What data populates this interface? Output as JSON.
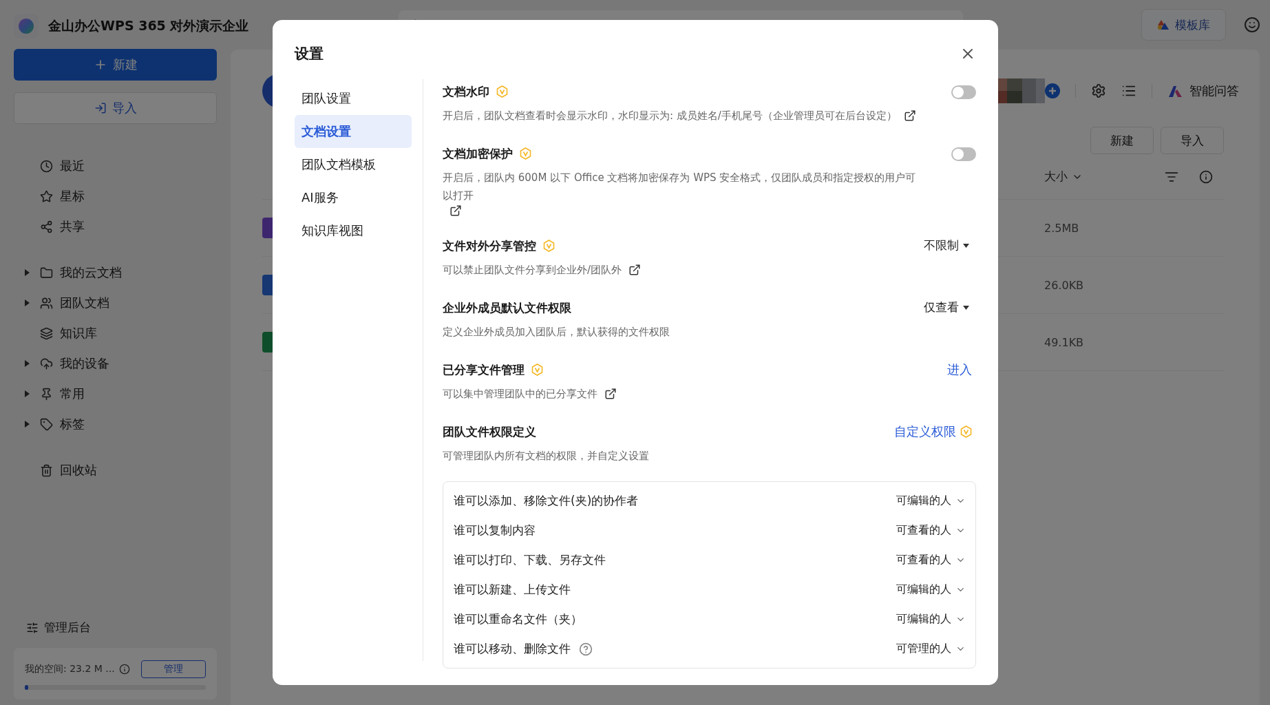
{
  "app": {
    "title": "金山办公WPS 365 对外演示企业",
    "template_button": "模板库"
  },
  "sidebar": {
    "new_button": "新建",
    "import_button": "导入",
    "nav_groups": [
      {
        "items": [
          {
            "label": "最近",
            "expandable": false
          },
          {
            "label": "星标",
            "expandable": false
          },
          {
            "label": "共享",
            "expandable": false
          }
        ]
      },
      {
        "items": [
          {
            "label": "我的云文档",
            "expandable": true
          },
          {
            "label": "团队文档",
            "expandable": true
          },
          {
            "label": "知识库",
            "expandable": false
          },
          {
            "label": "我的设备",
            "expandable": true
          },
          {
            "label": "常用",
            "expandable": true
          },
          {
            "label": "标签",
            "expandable": true
          }
        ]
      },
      {
        "items": [
          {
            "label": "回收站",
            "expandable": false
          }
        ]
      }
    ],
    "admin": "管理后台",
    "storage": {
      "label": "我的空间: 23.2 M ...",
      "button": "管理",
      "level": 0.02
    }
  },
  "main": {
    "assistant": "智能问答",
    "buttons": [
      "新建",
      "导入"
    ],
    "size_column": "大小",
    "rows": [
      {
        "size": "2.5MB"
      },
      {
        "size": "26.0KB"
      },
      {
        "size": "49.1KB"
      }
    ]
  },
  "dialog": {
    "title": "设置",
    "nav": [
      {
        "label": "团队设置",
        "selected": false
      },
      {
        "label": "文档设置",
        "selected": true
      },
      {
        "label": "团队文档模板",
        "selected": false
      },
      {
        "label": "AI服务",
        "selected": false
      },
      {
        "label": "知识库视图",
        "selected": false
      }
    ],
    "settings": [
      {
        "kind": "toggle",
        "title": "文档水印",
        "premium": true,
        "description": "开启后，团队文档查看时会显示水印，水印显示为: 成员姓名/手机尾号（企业管理员可在后台设定）",
        "external_link": true,
        "on": false
      },
      {
        "kind": "toggle",
        "title": "文档加密保护",
        "premium": true,
        "description": "开启后，团队内 600M 以下 Office 文档将加密保存为 WPS 安全格式，仅团队成员和指定授权的用户可以打开",
        "external_link": true,
        "on": false
      },
      {
        "kind": "dropdown",
        "title": "文件对外分享管控",
        "premium": true,
        "description": "可以禁止团队文件分享到企业外/团队外",
        "external_link": true,
        "value": "不限制"
      },
      {
        "kind": "dropdown",
        "title": "企业外成员默认文件权限",
        "premium": false,
        "description": "定义企业外成员加入团队后，默认获得的文件权限",
        "external_link": false,
        "value": "仅查看"
      },
      {
        "kind": "link",
        "title": "已分享文件管理",
        "premium": true,
        "description": "可以集中管理团队中的已分享文件",
        "external_link": true,
        "value": "进入"
      }
    ],
    "permissions": {
      "title": "团队文件权限定义",
      "link": "自定义权限",
      "premium": true,
      "description": "可管理团队内所有文档的权限，并自定义设置",
      "rows": [
        {
          "label": "谁可以添加、移除文件(夹)的协作者",
          "value": "可编辑的人",
          "help": false
        },
        {
          "label": "谁可以复制内容",
          "value": "可查看的人",
          "help": false
        },
        {
          "label": "谁可以打印、下载、另存文件",
          "value": "可查看的人",
          "help": false
        },
        {
          "label": "谁可以新建、上传文件",
          "value": "可编辑的人",
          "help": false
        },
        {
          "label": "谁可以重命名文件（夹）",
          "value": "可编辑的人",
          "help": false
        },
        {
          "label": "谁可以移动、删除文件",
          "value": "可管理的人",
          "help": true
        }
      ]
    }
  }
}
